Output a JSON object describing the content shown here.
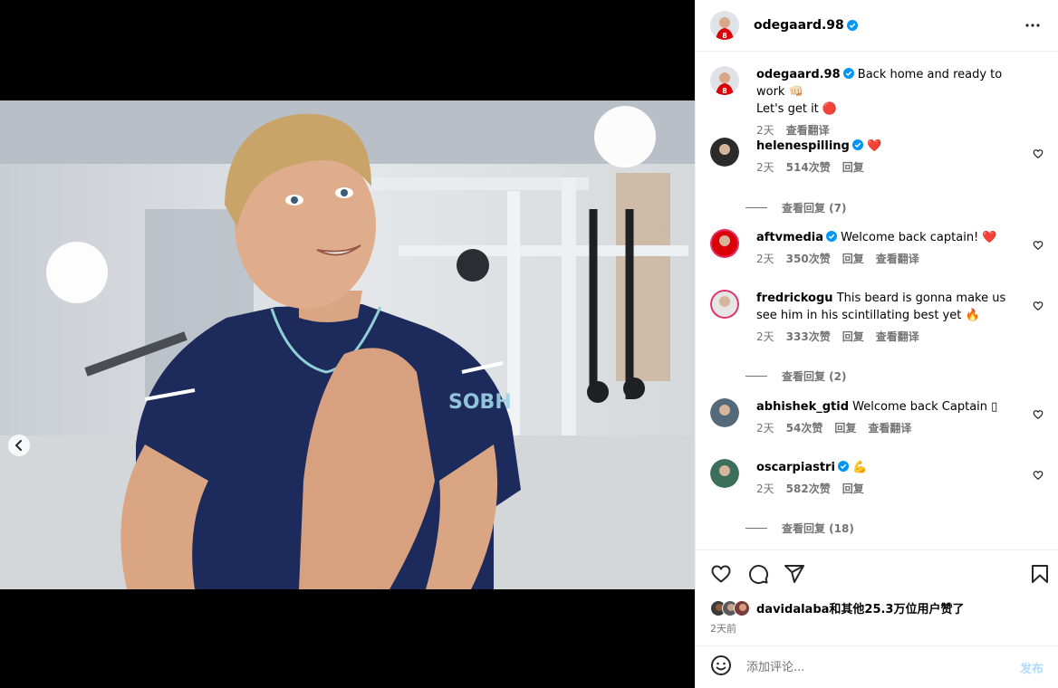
{
  "post": {
    "author": "odegaard.98",
    "more_icon": "more-horizontal-icon",
    "carousel_dots": 4,
    "active_dot": 4,
    "caption": {
      "username": "odegaard.98",
      "line1": "Back home and ready to work 👊🏻",
      "line2": "Let's get it 🔴",
      "time": "2天",
      "translate": "查看翻译"
    },
    "comments": [
      {
        "username": "helenespilling",
        "verified": true,
        "text": "❤️",
        "time": "2天",
        "likes": "514次赞",
        "reply": "回复",
        "translate": "",
        "view_replies": "查看回复 (7)"
      },
      {
        "username": "aftvmedia",
        "verified": true,
        "text": "Welcome back captain! ❤️",
        "time": "2天",
        "likes": "350次赞",
        "reply": "回复",
        "translate": "查看翻译",
        "view_replies": ""
      },
      {
        "username": "fredrickogu",
        "verified": false,
        "text": "This beard is gonna make us see him in his scintillating best yet 🔥",
        "time": "2天",
        "likes": "333次赞",
        "reply": "回复",
        "translate": "查看翻译",
        "view_replies": "查看回复 (2)"
      },
      {
        "username": "abhishek_gtid",
        "verified": false,
        "text": "Welcome back Captain ▯",
        "time": "2天",
        "likes": "54次赞",
        "reply": "回复",
        "translate": "查看翻译",
        "view_replies": ""
      },
      {
        "username": "oscarpiastri",
        "verified": true,
        "text": "💪",
        "time": "2天",
        "likes": "582次赞",
        "reply": "回复",
        "translate": "",
        "view_replies": "查看回复 (18)"
      }
    ],
    "liked_by": "davidalaba和其他25.3万位用户赞了",
    "posted_ago": "2天前",
    "comment_placeholder": "添加评论...",
    "post_label": "发布"
  },
  "colors": {
    "verified": "#0095f6",
    "arsenal_red": "#db0007",
    "jersey_navy": "#1d2a5c"
  }
}
